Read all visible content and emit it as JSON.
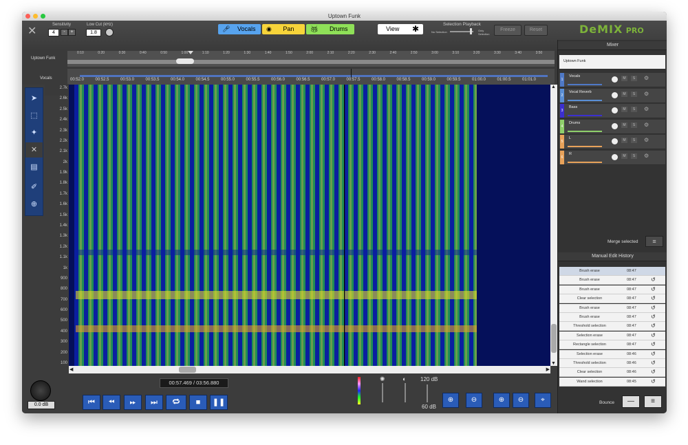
{
  "window": {
    "title": "Uptown Funk"
  },
  "toolbar": {
    "sensitivity_label": "Sensitivity",
    "sensitivity_value": "4",
    "minus": "-",
    "plus": "+",
    "lowcut_label": "Low Cut (kHz)",
    "lowcut_value": "1.8",
    "modes": [
      "Vocals",
      "Pan",
      "Drums"
    ],
    "view_label": "View",
    "selection_playback_label": "Selection Playback",
    "no_selection": "No Selection",
    "only_selection": "Only Selection",
    "freeze_label": "Freeze",
    "reset_label": "Reset",
    "brand": "DeMIX",
    "brand_suffix": "PRO",
    "accent": "#7db33a"
  },
  "overview": {
    "track_main": "Uptown Funk",
    "track_vocals": "Vocals",
    "ruler": [
      "0:10",
      "0:20",
      "0:30",
      "0:40",
      "0:50",
      "1:00",
      "1:10",
      "1:20",
      "1:30",
      "1:40",
      "1:50",
      "2:00",
      "2:10",
      "2:20",
      "2:30",
      "2:40",
      "2:50",
      "3:00",
      "3:10",
      "3:20",
      "3:30",
      "3:40",
      "3:50"
    ]
  },
  "spectrogram": {
    "time_ticks": [
      "00:52.0",
      "00:52.5",
      "00:53.0",
      "00:53.5",
      "00:54.0",
      "00:54.5",
      "00:55.0",
      "00:55.5",
      "00:56.0",
      "00:56.5",
      "00:57.0",
      "00:57.5",
      "00:58.0",
      "00:58.5",
      "00:59.0",
      "00:59.5",
      "01:00.0",
      "01:00.5",
      "01:01.0"
    ],
    "freq_ticks": [
      "2.7k",
      "2.6k",
      "2.5k",
      "2.4k",
      "2.3k",
      "2.2k",
      "2.1k",
      "2k",
      "1.9k",
      "1.8k",
      "1.7k",
      "1.6k",
      "1.5k",
      "1.4k",
      "1.3k",
      "1.2k",
      "1.1k",
      "1k",
      "900",
      "800",
      "700",
      "600",
      "500",
      "400",
      "300",
      "200",
      "100"
    ]
  },
  "transport": {
    "time_display": "00:57.469 / 03:56.880",
    "gain_display": "0.0 dB",
    "db_top": "120 dB",
    "db_bottom": "60 dB"
  },
  "mixer": {
    "title": "Mixer",
    "master": "Uptown Funk",
    "tracks": [
      {
        "num": "1",
        "name": "Vocals",
        "color": "#4f79c7"
      },
      {
        "num": "2",
        "name": "Vocal Reverb",
        "color": "#5a8fd6"
      },
      {
        "num": "3",
        "name": "Bass",
        "color": "#3b2fd0"
      },
      {
        "num": "4",
        "name": "Drums",
        "color": "#8fd06b"
      },
      {
        "num": "5",
        "name": "L",
        "color": "#e8a25a"
      },
      {
        "num": "6",
        "name": "R",
        "color": "#e8a25a"
      }
    ],
    "mute": "M",
    "solo": "S",
    "merge_label": "Merge selected"
  },
  "history": {
    "title": "Manual Edit History",
    "items": [
      {
        "name": "Brush erase",
        "time": "08:47"
      },
      {
        "name": "Brush erase",
        "time": "08:47"
      },
      {
        "name": "Brush erase",
        "time": "08:47"
      },
      {
        "name": "Clear selection",
        "time": "08:47"
      },
      {
        "name": "Brush erase",
        "time": "08:47"
      },
      {
        "name": "Brush erase",
        "time": "08:47"
      },
      {
        "name": "Threshold selection",
        "time": "08:47"
      },
      {
        "name": "Selection erase",
        "time": "08:47"
      },
      {
        "name": "Rectangle selection",
        "time": "08:47"
      },
      {
        "name": "Selection erase",
        "time": "08:46"
      },
      {
        "name": "Threshold selection",
        "time": "08:46"
      },
      {
        "name": "Clear selection",
        "time": "08:46"
      },
      {
        "name": "Wand selection",
        "time": "08:45"
      }
    ],
    "bounce_label": "Bounce"
  }
}
